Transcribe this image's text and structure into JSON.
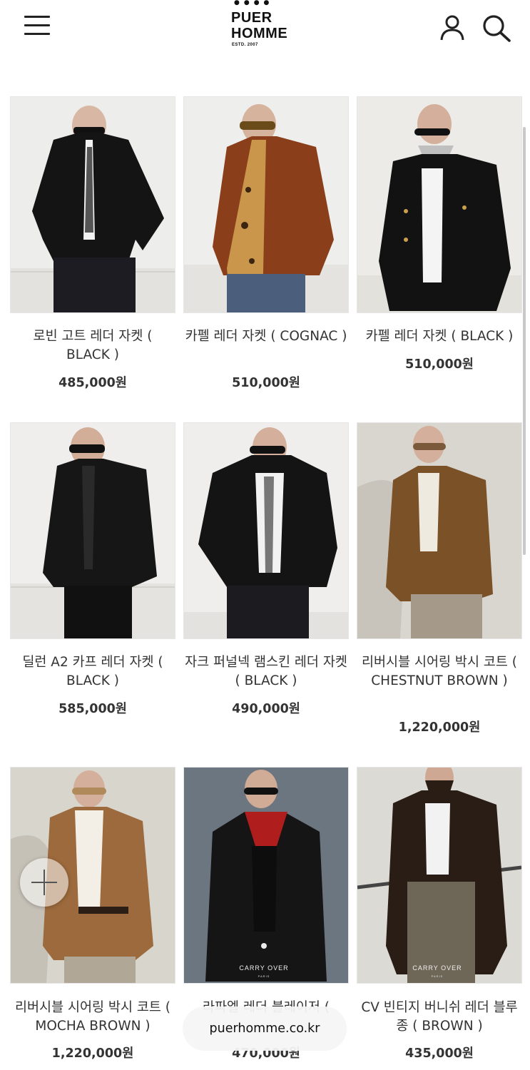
{
  "header": {
    "logo_line1": "PUER",
    "logo_line2": "HOMME",
    "logo_sub": "ESTD. 2007"
  },
  "products": [
    {
      "name": "로빈 고트 레더 자켓 ( BLACK )",
      "price": "485,000원"
    },
    {
      "name": "카펠 레더 자켓 ( COGNAC )",
      "price": "510,000원"
    },
    {
      "name": "카펠 레더 자켓 ( BLACK )",
      "price": "510,000원"
    },
    {
      "name": "딜런 A2 카프 레더 자켓 ( BLACK )",
      "price": "585,000원"
    },
    {
      "name": "자크 퍼널넥 램스킨 레더 자켓 ( BLACK )",
      "price": "490,000원"
    },
    {
      "name": "리버시블 시어링 박시 코트 ( CHESTNUT BROWN )",
      "price": "1,220,000원"
    },
    {
      "name": "리버시블 시어링 박시 코트 ( MOCHA BROWN )",
      "price": "1,220,000원"
    },
    {
      "name": "라파엘 레더 블레이저 (",
      "price": "470,000원"
    },
    {
      "name": "CV 빈티지 버니쉬 레더 블루종 ( BROWN )",
      "price": "435,000원"
    }
  ],
  "image_overlays": {
    "carry_over": "CARRY OVER",
    "paris": "PARIS"
  },
  "url_pill": "puerhomme.co.kr"
}
